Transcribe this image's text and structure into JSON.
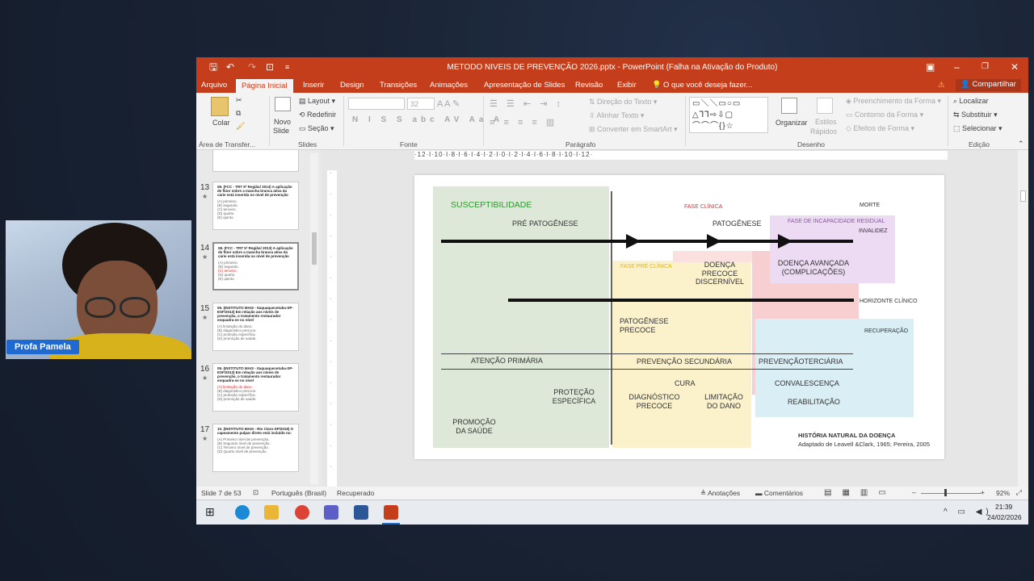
{
  "window": {
    "title": "METODO NIVEIS DE PREVENÇÃO 2026.pptx - PowerPoint (Falha na Ativação do Produto)"
  },
  "menu": {
    "tabs": [
      "Arquivo",
      "Página Inicial",
      "Inserir",
      "Design",
      "Transições",
      "Animações",
      "Apresentação de Slides",
      "Revisão",
      "Exibir"
    ],
    "search": "O que você deseja fazer...",
    "share": "Compartilhar"
  },
  "ribbon": {
    "clipboard": {
      "paste": "Colar",
      "group": "Área de Transfer..."
    },
    "slides": {
      "new": "Novo",
      "new2": "Slide",
      "layout": "Layout",
      "reset": "Redefinir",
      "section": "Seção",
      "group": "Slides"
    },
    "font": {
      "size": "32",
      "group": "Fonte"
    },
    "paragraph": {
      "dir": "Direção do Texto",
      "align": "Alinhar Texto",
      "smart": "Converter em SmartArt",
      "group": "Parágrafo"
    },
    "drawing": {
      "organize": "Organizar",
      "styles": "Estilos",
      "styles2": "Rápidos",
      "fill": "Preenchimento da Forma",
      "outline": "Contorno da Forma",
      "effects": "Efeitos de Forma",
      "group": "Desenho"
    },
    "editing": {
      "find": "Localizar",
      "replace": "Substituir",
      "select": "Selecionar",
      "group": "Edição"
    }
  },
  "ruler": {
    "h": "·12·l·10·l·8·l·6·l·4·l·2·l·0·l·2·l·4·l·6·l·8·l·10·l·12·"
  },
  "thumbs": [
    {
      "num": "13",
      "text": "08. (FCC - TRT 5ª Região/ 2013) A aplicação de flúor sobre a mancha branca ativa da cárie está inserida no nível de prevenção",
      "opts": [
        "(A) primeiro.",
        "(B) segundo.",
        "(C) terceiro.",
        "(D) quarto.",
        "(E) quinto."
      ]
    },
    {
      "num": "14",
      "text": "08. (FCC - TRT 5ª Região/ 2013) A aplicação de flúor sobre a mancha branca ativa da cárie está inserida no nível de prevenção",
      "opts": [
        "(A) primeiro.",
        "(B) segundo.",
        "(C) terceiro.",
        "(D) quarto.",
        "(E) quinto."
      ]
    },
    {
      "num": "15",
      "text": "09. (INSTITUTO MAIS - Itaquaquecetuba-SP- ESF/2013) Em relação aos níveis de prevenção, o tratamento restaurador enquadra-se no nível",
      "opts": [
        "(A) limitação do dano.",
        "(B) diagnóstico precoce.",
        "(C) proteção específica.",
        "(D) promoção de saúde."
      ]
    },
    {
      "num": "16",
      "text": "09. (INSTITUTO MAIS - Itaquaquecetuba-SP- ESF/2013) Em relação aos níveis de prevenção, o tratamento restaurador enquadra-se no nível",
      "opts": [
        "(A) limitação do dano.",
        "(B) diagnóstico precoce.",
        "(C) proteção específica.",
        "(D) promoção de saúde."
      ]
    },
    {
      "num": "17",
      "text": "10. (INSTITUTO MAIS - Rio Claro-SP/2019) O capeamento pulpar direto está incluído no:",
      "opts": [
        "(A) Primeiro nível de prevenção.",
        "(B) Segundo nível de prevenção.",
        "(C) Terceiro nível de prevenção.",
        "(D) Quarto nível de prevenção."
      ]
    }
  ],
  "slide": {
    "susc": "SUSCEPTIBILIDADE",
    "prepat": "PRÉ PATOGÊNESE",
    "faseclin": "FASE CLÍNICA",
    "patog": "PATOGÊNESE",
    "morte": "MORTE",
    "faseinc": "FASE DE INCAPACIDADE RESIDUAL",
    "invalidez": "INVALIDEZ",
    "fasepre": "FASE PRÉ CLÍNICA",
    "doenca1": "DOENÇA",
    "doenca2": "PRECOCE",
    "doenca3": "DISCERNÍVEL",
    "adv1": "DOENÇA AVANÇADA",
    "adv2": "(COMPLICAÇÕES)",
    "horiz": "HORIZONTE CLÍNICO",
    "patprec1": "PATOGÊNESE",
    "patprec2": "PRECOCE",
    "recup": "RECUPERAÇÃO",
    "ap": "ATENÇÃO  PRIMÁRIA",
    "ps": "PREVENÇÃO SECUNDÁRIA",
    "pt": "PREVENÇÃOTERCIÁRIA",
    "cura": "CURA",
    "conval": "CONVALESCENÇA",
    "prot1": "PROTEÇÃO",
    "prot2": "ESPECÍFICA",
    "diag1": "DIAGNÓSTICO",
    "diag2": "PRECOCE",
    "lim1": "LIMITAÇÃO",
    "lim2": "DO DANO",
    "reab": "REABILITAÇÃO",
    "prom1": "PROMOÇÃO",
    "prom2": "DA SAÚDE",
    "hist": "HISTÓRIA NATURAL DA DOENÇA",
    "ref": "Adaptado de Leavell &Clark, 1965; Pereira, 2005"
  },
  "status": {
    "slide": "Slide 7 de 53",
    "lang": "Português (Brasil)",
    "rec": "Recuperado",
    "notes": "Anotações",
    "comments": "Comentários",
    "zoom": "92%"
  },
  "taskbar": {
    "time": "21:39",
    "date": "24/02/2026"
  },
  "webcam": {
    "name": "Profa Pamela"
  }
}
